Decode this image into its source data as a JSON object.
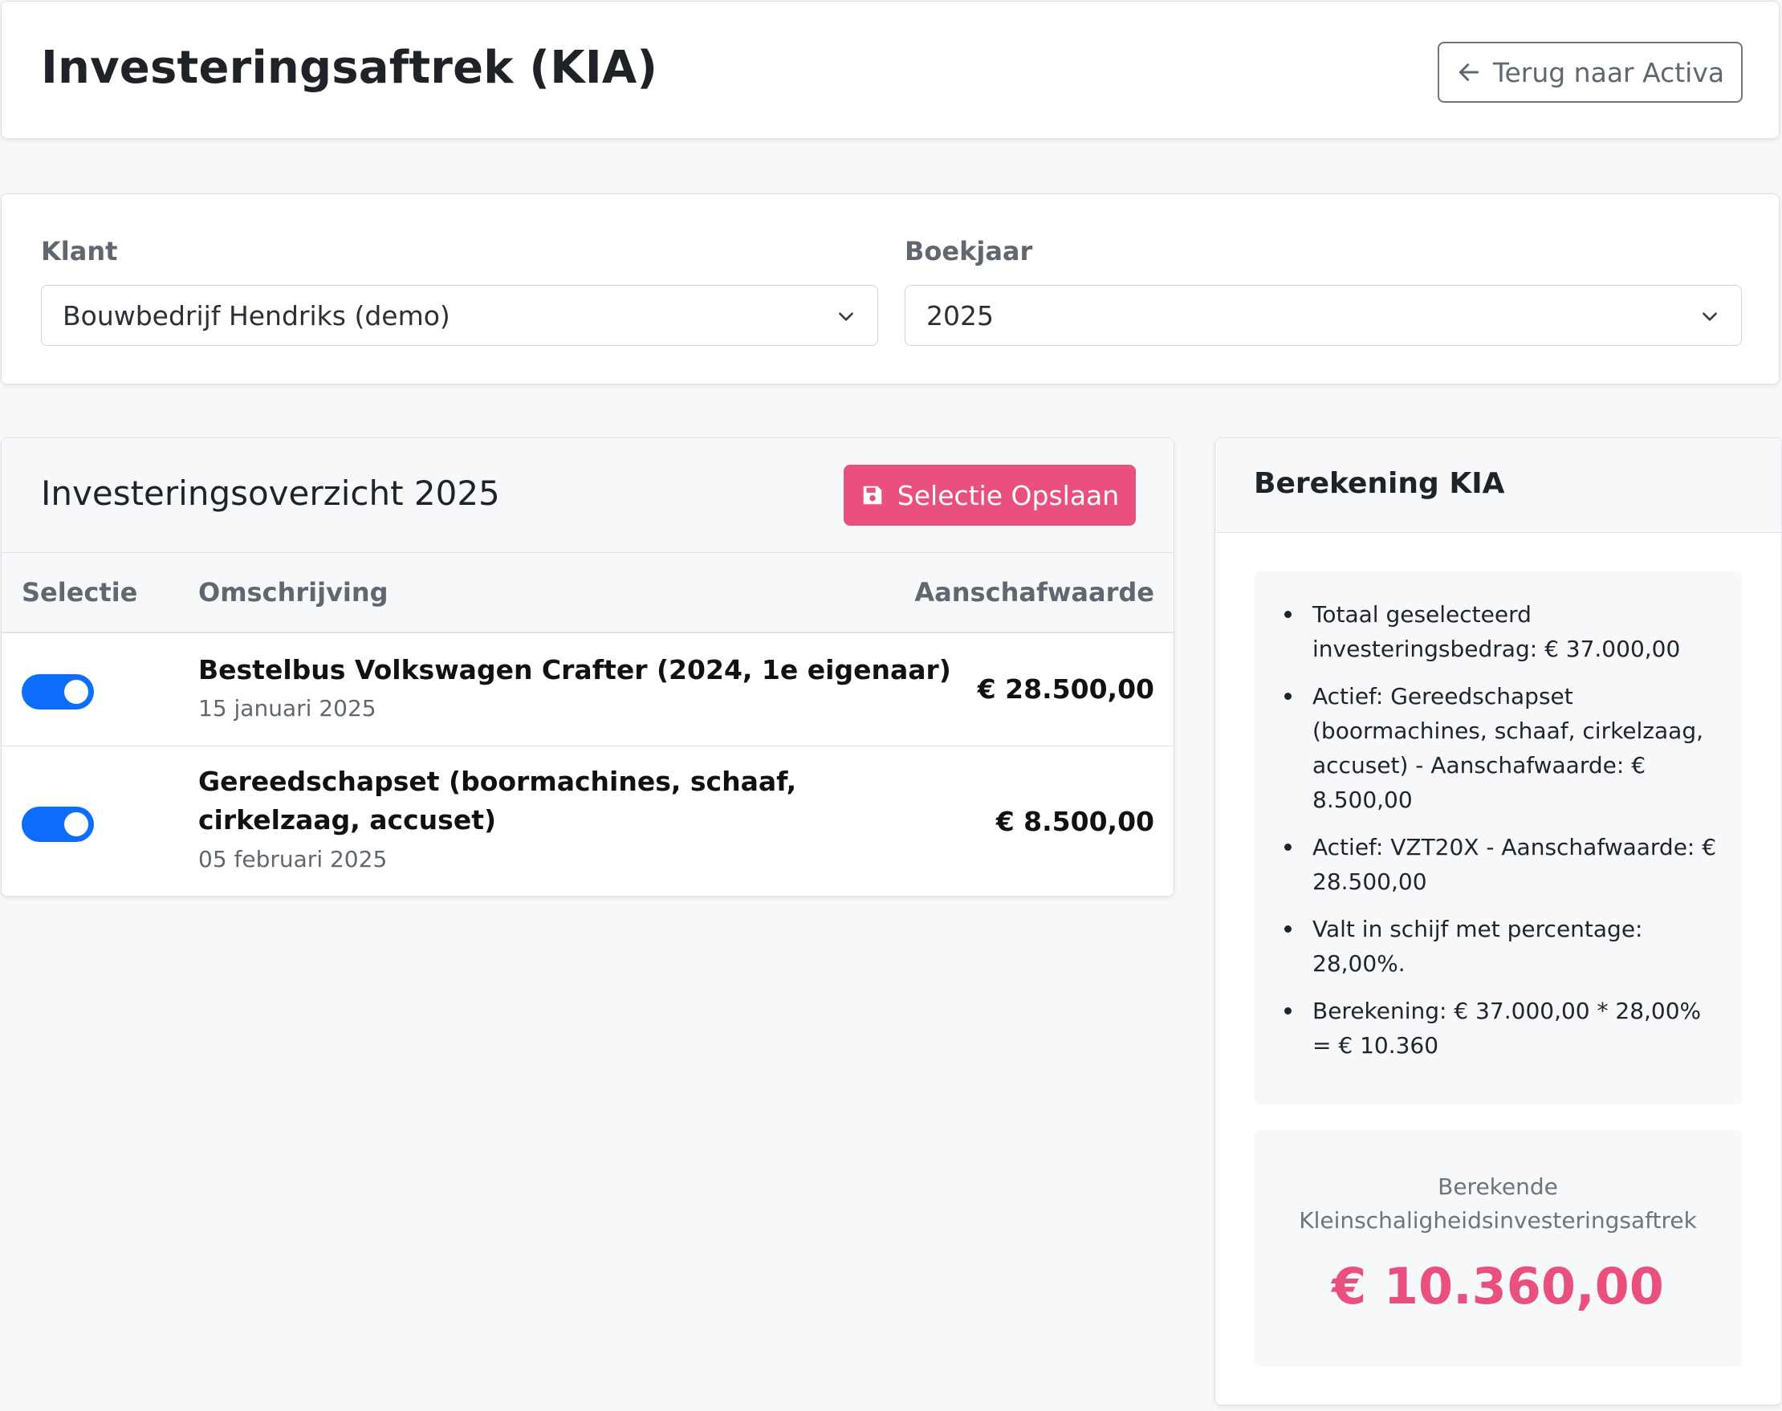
{
  "header": {
    "title": "Investeringsaftrek (KIA)",
    "back_label": "Terug naar Activa"
  },
  "filters": {
    "client_label": "Klant",
    "client_value": "Bouwbedrijf Hendriks (demo)",
    "year_label": "Boekjaar",
    "year_value": "2025"
  },
  "overview": {
    "title": "Investeringsoverzicht 2025",
    "save_label": "Selectie Opslaan",
    "columns": [
      "Selectie",
      "Omschrijving",
      "Aanschafwaarde"
    ],
    "rows": [
      {
        "selected": true,
        "title": "Bestelbus Volkswagen Crafter (2024, 1e eigenaar)",
        "date": "15 januari 2025",
        "amount": "€ 28.500,00"
      },
      {
        "selected": true,
        "title": "Gereedschapset (boormachines, schaaf, cirkelzaag, accuset)",
        "date": "05 februari 2025",
        "amount": "€ 8.500,00"
      }
    ]
  },
  "kia": {
    "title": "Berekening KIA",
    "lines": [
      "Totaal geselecteerd investeringsbedrag: € 37.000,00",
      "Actief: Gereedschapset (boormachines, schaaf, cirkelzaag, accuset) - Aanschafwaarde: € 8.500,00",
      "Actief: VZT20X - Aanschafwaarde: € 28.500,00",
      "Valt in schijf met percentage: 28,00%.",
      "Berekening: € 37.000,00 * 28,00% = € 10.360"
    ],
    "result_label": "Berekende Kleinschaligheidsinvesteringsaftrek",
    "result_value": "€ 10.360,00"
  },
  "colors": {
    "accent": "#e9507e",
    "toggle_on": "#0d6efd",
    "background": "#f7f8fa"
  },
  "icons": {
    "back": "arrow-left-icon",
    "save": "floppy-disk-icon",
    "dropdown": "chevron-down-icon"
  }
}
